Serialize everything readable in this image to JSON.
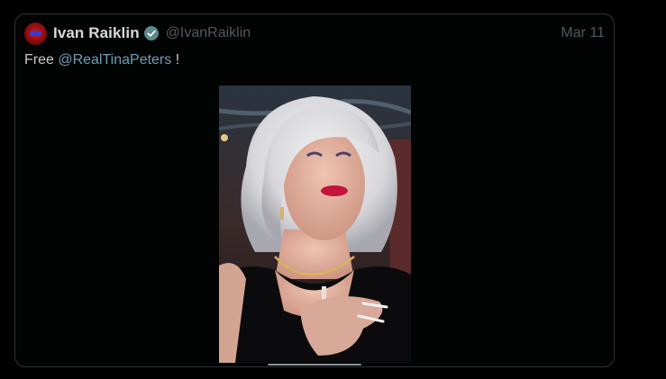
{
  "tweet": {
    "display_name": "Ivan Raiklin",
    "handle": "@IvanRaiklin",
    "date": "Mar 11",
    "text_prefix": "Free ",
    "mention": "@RealTinaPeters",
    "text_suffix": " !"
  },
  "icons": {
    "avatar": "avatar-icon",
    "verified": "verified-badge-icon"
  },
  "colors": {
    "background": "#000000",
    "card_border": "#2f3336",
    "name": "#d9d9d9",
    "muted": "#4f5a5f",
    "mention": "#6f9db4",
    "verified": "#5c8a8c"
  }
}
